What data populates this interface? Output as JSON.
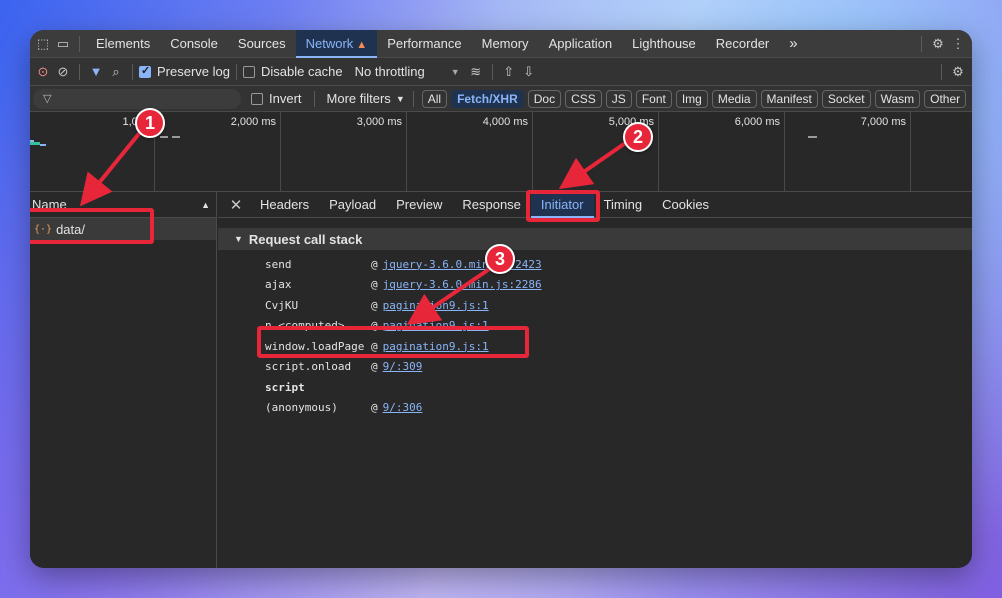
{
  "tabs": [
    {
      "label": "Elements"
    },
    {
      "label": "Console"
    },
    {
      "label": "Sources"
    },
    {
      "label": "Network",
      "active": true,
      "warning": "▲"
    },
    {
      "label": "Performance"
    },
    {
      "label": "Memory"
    },
    {
      "label": "Application"
    },
    {
      "label": "Lighthouse"
    },
    {
      "label": "Recorder"
    }
  ],
  "more_tabs": "»",
  "toolbar": {
    "preserve_log": "Preserve log",
    "disable_cache": "Disable cache",
    "throttling": "No throttling"
  },
  "filter": {
    "placeholder": "",
    "invert": "Invert",
    "more_filters": "More filters",
    "types": [
      "All",
      "Fetch/XHR",
      "Doc",
      "CSS",
      "JS",
      "Font",
      "Img",
      "Media",
      "Manifest",
      "Socket",
      "Wasm",
      "Other"
    ],
    "active_type": "Fetch/XHR"
  },
  "timeline": {
    "ticks": [
      "1,000",
      "2,000 ms",
      "3,000 ms",
      "4,000 ms",
      "5,000 ms",
      "6,000 ms",
      "7,000 ms"
    ]
  },
  "requests": {
    "header": "Name",
    "sort_icon": "▲",
    "items": [
      {
        "name": "data/"
      }
    ]
  },
  "detail_tabs": [
    "Headers",
    "Payload",
    "Preview",
    "Response",
    "Initiator",
    "Timing",
    "Cookies"
  ],
  "active_detail_tab": "Initiator",
  "call_stack": {
    "title": "Request call stack",
    "frames": [
      {
        "fn": "send",
        "loc": "jquery-3.6.0.min.js:2423"
      },
      {
        "fn": "ajax",
        "loc": "jquery-3.6.0.min.js:2286"
      },
      {
        "fn": "CvjKU",
        "loc": "pagination9.js:1"
      },
      {
        "fn": "n.<computed>",
        "loc": "pagination9.js:1"
      },
      {
        "fn": "window.loadPage",
        "loc": "pagination9.js:1"
      },
      {
        "fn": "script.onload",
        "loc": "9/:309"
      },
      {
        "fn": "script",
        "loc": ""
      },
      {
        "fn": "(anonymous)",
        "loc": "9/:306"
      }
    ]
  },
  "annotations": {
    "badges": [
      "1",
      "2",
      "3"
    ],
    "color": "#e8263a"
  },
  "colors": {
    "accent": "#8ab4f8",
    "panel": "#282828",
    "warning": "#f28b54"
  }
}
